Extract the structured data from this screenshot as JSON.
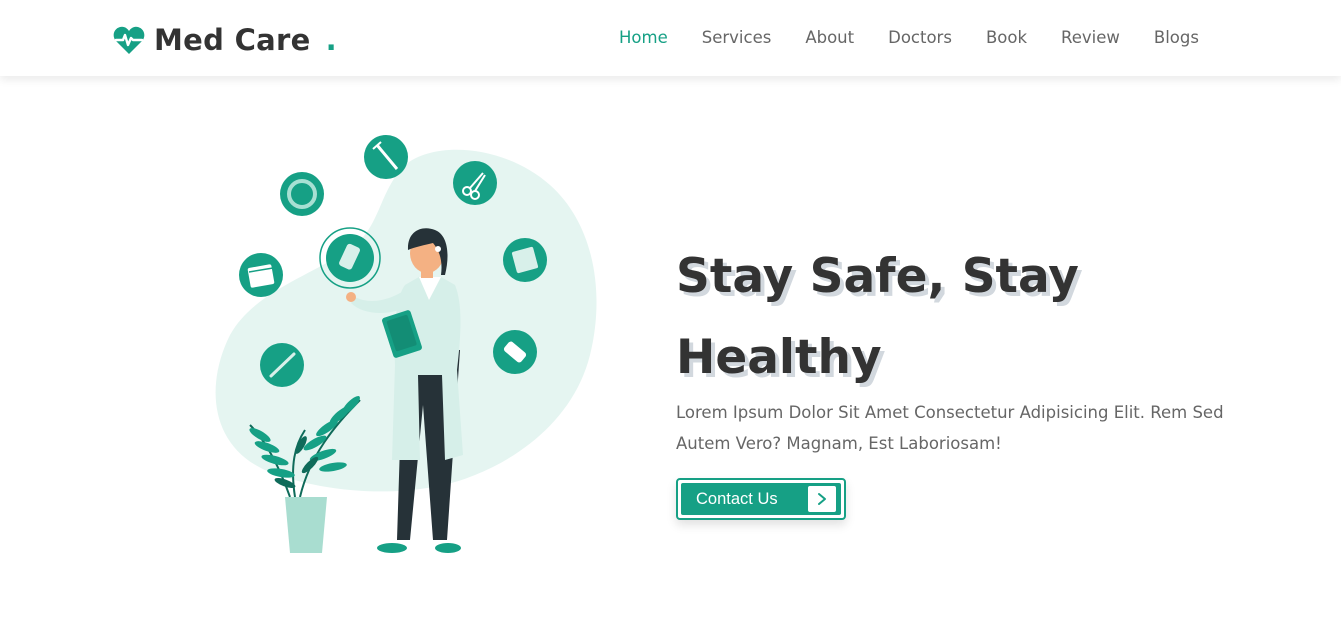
{
  "header": {
    "brand": {
      "name": "Med Care",
      "dot": ".",
      "icon": "heart-pulse-icon"
    },
    "nav": [
      {
        "label": "Home",
        "active": true
      },
      {
        "label": "Services",
        "active": false
      },
      {
        "label": "About",
        "active": false
      },
      {
        "label": "Doctors",
        "active": false
      },
      {
        "label": "Book",
        "active": false
      },
      {
        "label": "Review",
        "active": false
      },
      {
        "label": "Blogs",
        "active": false
      }
    ]
  },
  "hero": {
    "title": "Stay Safe, Stay Healthy",
    "text": "Lorem Ipsum Dolor Sit Amet Consectetur Adipisicing Elit. Rem Sed Autem Vero? Magnam, Est Laboriosam!",
    "button": {
      "label": "Contact Us",
      "icon": "chevron-right-icon"
    },
    "illustration_icons": [
      "syringe-icon",
      "scissors-icon",
      "ring-icon",
      "pill-icon",
      "calendar-icon",
      "package-icon",
      "capsule-pack-icon",
      "thermometer-icon"
    ]
  },
  "colors": {
    "accent": "#16a085",
    "text_dark": "#333333",
    "text_muted": "#666666",
    "blob": "#e5f5f1"
  }
}
